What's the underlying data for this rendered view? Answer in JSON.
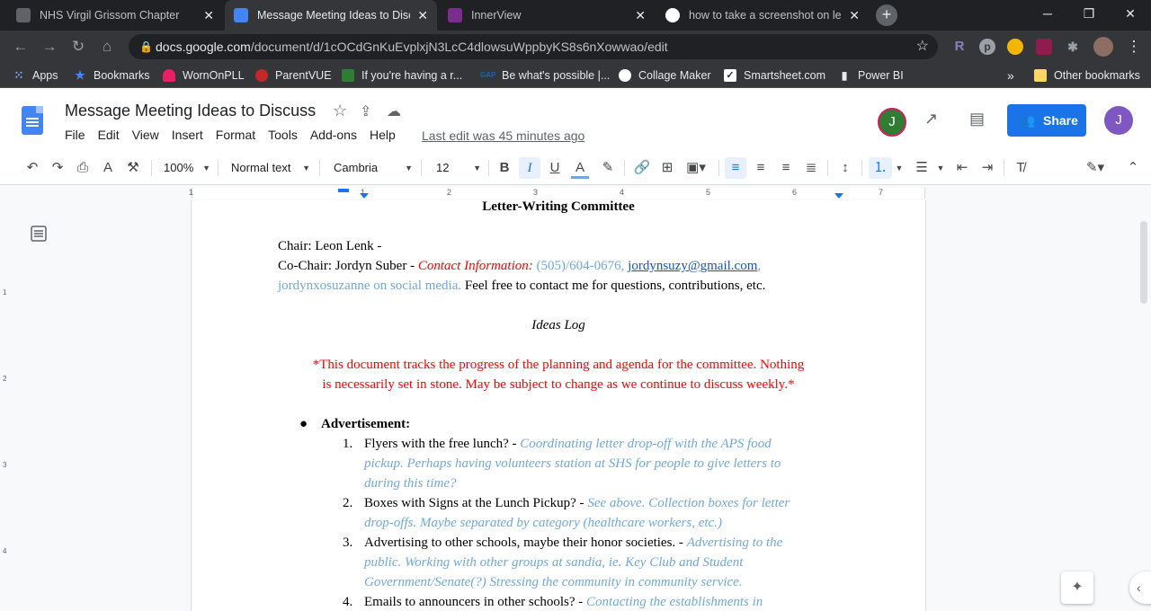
{
  "browser": {
    "tabs": [
      {
        "title": "NHS Virgil Grissom Chapter"
      },
      {
        "title": "Message Meeting Ideas to Discuss"
      },
      {
        "title": "InnerView"
      },
      {
        "title": "how to take a screenshot on lenovo"
      }
    ],
    "url_host": "docs.google.com",
    "url_path": "/document/d/1cOCdGnKuEvplxjN3LcC4dlowsuWppbyKS8s6nXowwao/edit",
    "bookmarks": [
      "Apps",
      "Bookmarks",
      "WornOnPLL",
      "ParentVUE",
      "If you're having a r...",
      "Be what's possible |...",
      "Collage Maker",
      "Smartsheet.com",
      "Power BI",
      "Other bookmarks"
    ],
    "bookmark_more": "»"
  },
  "docs": {
    "title": "Message Meeting Ideas to Discuss",
    "menu": [
      "File",
      "Edit",
      "View",
      "Insert",
      "Format",
      "Tools",
      "Add-ons",
      "Help"
    ],
    "last_edit": "Last edit was 45 minutes ago",
    "share_label": "Share",
    "collaborator_initial": "J",
    "account_initial": "J",
    "toolbar": {
      "zoom": "100%",
      "style": "Normal text",
      "font": "Cambria",
      "size": "12"
    },
    "ruler_numbers": [
      "1",
      "1",
      "2",
      "3",
      "4",
      "5",
      "6",
      "7"
    ],
    "vruler_numbers": [
      "1",
      "2",
      "3",
      "4"
    ]
  },
  "document": {
    "heading": "Letter-Writing Committee",
    "chair": "Chair: Leon Lenk -",
    "cochair_prefix": "Co-Chair: Jordyn Suber - ",
    "contact_label": "Contact Information:",
    "phone": " (505)/604-0676, ",
    "email": "jordynsuzy@gmail.com",
    "email_after": ",",
    "social": "jordynxosuzanne on social media.",
    "contact_note": " Feel free to contact me for questions, contributions, etc.",
    "ideas_log": "Ideas Log",
    "disclaimer_1": "*This document tracks the progress of the planning and agenda for the committee. Nothing",
    "disclaimer_2": "is necessarily set in stone. May be subject to change as we continue to discuss weekly.*",
    "section": "Advertisement:",
    "items": [
      {
        "num": "1.",
        "text": "Flyers with the free lunch? - ",
        "note_lines": [
          "Coordinating letter drop-off with the APS food",
          "pickup. Perhaps having volunteers station at SHS for people to give letters to",
          "during this time?"
        ]
      },
      {
        "num": "2.",
        "text": "Boxes with Signs at the Lunch Pickup? - ",
        "note_lines": [
          "See above. Collection boxes for letter",
          "drop-offs. Maybe separated by category (healthcare workers, etc.)"
        ]
      },
      {
        "num": "3.",
        "text": "Advertising to other schools, maybe their honor societies. - ",
        "note_lines": [
          "Advertising to the",
          "public. Working with other groups at sandia, ie. Key Club and Student",
          "Government/Senate(?) Stressing the community in community service."
        ]
      },
      {
        "num": "4.",
        "text": "Emails to announcers in other schools? - ",
        "note_lines": [
          "Contacting the establishments in"
        ]
      }
    ]
  }
}
